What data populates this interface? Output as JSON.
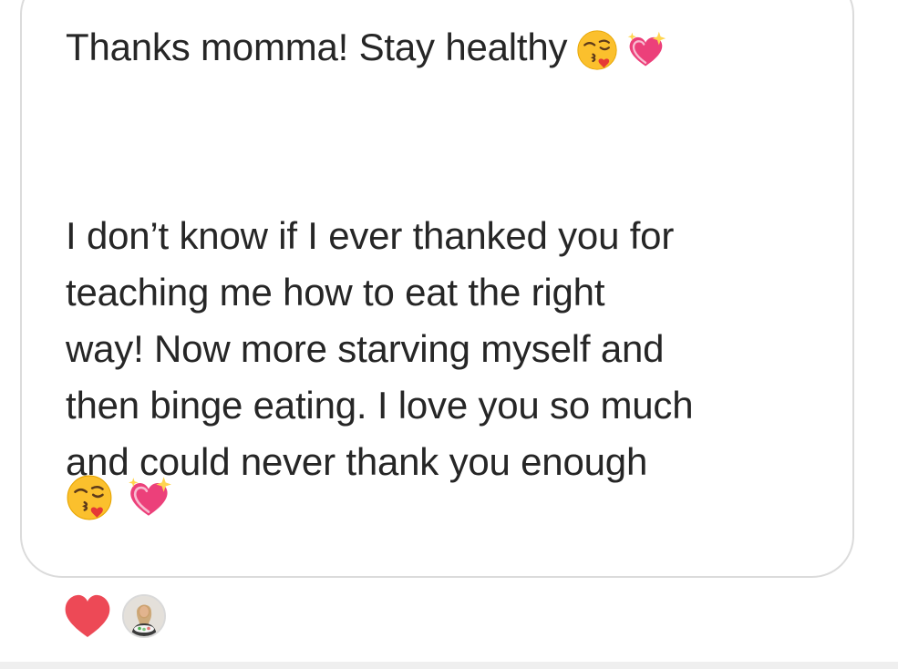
{
  "message": {
    "greeting_text": "Thanks momma! Stay healthy",
    "body_lines": [
      "I don’t know if I ever thanked you for",
      "teaching me how to eat the right",
      "way! Now more starving myself and",
      "then binge eating. I love you so much",
      "and could never thank you enough"
    ],
    "emoji_names": [
      "kissing-face-with-heart-icon",
      "sparkling-heart-icon"
    ]
  },
  "reaction": {
    "icon": "red-heart-icon",
    "color": "#ed4956"
  },
  "colors": {
    "bubble_border": "#dbdbdb",
    "text": "#262626",
    "bottom_bar": "#efefef"
  }
}
